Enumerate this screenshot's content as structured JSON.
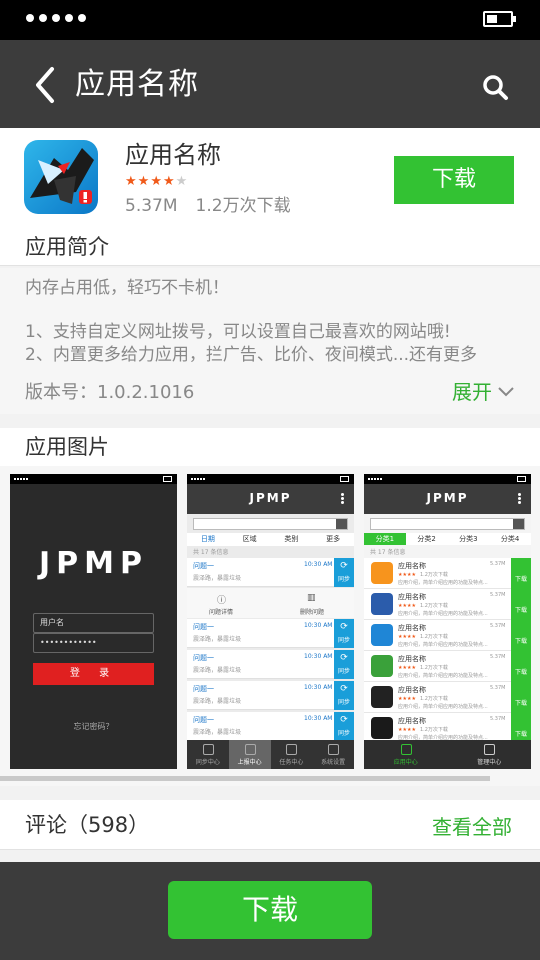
{
  "app": {
    "page_title": "应用名称",
    "name": "应用名称",
    "rating": 4,
    "rating_max": 5,
    "size": "5.37M",
    "downloads": "1.2万次下载",
    "download_label": "下载",
    "accent_color": "#33c233",
    "header_color": "#3c3c3c"
  },
  "intro": {
    "header": "应用简介",
    "line1": "内存占用低，轻巧不卡机！",
    "line2": "1、支持自定义网址拨号，可以设置自己最喜欢的网站哦!",
    "line3": "2、内置更多给力应用，拦广告、比价、夜间模式...还有更多",
    "version": "版本号：1.0.2.1016",
    "expand_label": "展开"
  },
  "screenshots": {
    "header": "应用图片",
    "shot1": {
      "logo": "JPMP",
      "username_label": "用户名",
      "password_mask": "••••••••••••",
      "login_label": "登 录",
      "forgot_label": "忘记密码？"
    },
    "shot2": {
      "logo": "JPMP",
      "filters": [
        "日期",
        "区域",
        "类别",
        "更多"
      ],
      "count": "共 17 条信息",
      "row_title": "问题一",
      "row_desc": "震泽路，暴露垃圾",
      "row_time": "10:30 AM",
      "sync_label": "同步",
      "action_detail": "问题详情",
      "action_delete": "删除问题",
      "tabs": [
        "同步中心",
        "上报中心",
        "任务中心",
        "系统设置"
      ]
    },
    "shot3": {
      "logo": "JPMP",
      "tabs": [
        "分类1",
        "分类2",
        "分类3",
        "分类4"
      ],
      "count": "共 17 条信息",
      "item_name": "应用名称",
      "item_downloads": "1.2万次下载",
      "item_desc": "应用介绍，简单介绍应用的功能及特点...",
      "item_size": "5.37M",
      "dl_label": "下载",
      "bottom_tabs": [
        "应用中心",
        "管理中心"
      ]
    }
  },
  "comments": {
    "label": "评论（598）",
    "view_all": "查看全部"
  },
  "bottom": {
    "download_label": "下载"
  },
  "icons": [
    "back-arrow-icon",
    "search-icon",
    "chevron-down-icon",
    "battery-icon"
  ]
}
